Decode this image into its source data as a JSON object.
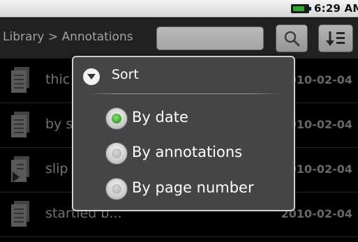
{
  "status_bar": {
    "time": "6:29 AM"
  },
  "title_bar": {
    "breadcrumb": "Library > Annotations",
    "search": {
      "value": ""
    }
  },
  "list": {
    "rows": [
      {
        "title": "thic",
        "date": "2010-02-04"
      },
      {
        "title": "by s",
        "date": "2010-02-04"
      },
      {
        "title": "slip",
        "date": "2010-02-04"
      },
      {
        "title": "startled b...",
        "date": "2010-02-04"
      }
    ]
  },
  "sort_dialog": {
    "title": "Sort",
    "options": [
      {
        "label": "By date",
        "selected": true
      },
      {
        "label": "By annotations",
        "selected": false
      },
      {
        "label": "By page number",
        "selected": false
      }
    ]
  },
  "colors": {
    "radio_selected": "#2e9e1e",
    "dialog_bg": "#454545",
    "titlebar_bg": "#2c2c2c"
  }
}
